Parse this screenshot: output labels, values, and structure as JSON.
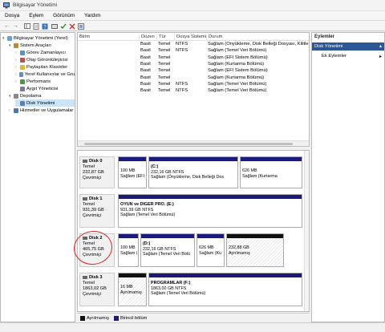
{
  "window": {
    "title": "Bilgisayar Yönetimi"
  },
  "menu": [
    "Dosya",
    "Eylem",
    "Görünüm",
    "Yardım"
  ],
  "tree": [
    {
      "label": "Bilgisayar Yönetimi (Yerel)",
      "indent": 0,
      "icon": "computer-icon"
    },
    {
      "label": "Sistem Araçları",
      "indent": 1,
      "icon": "tools-icon"
    },
    {
      "label": "Görev Zamanlayıcı",
      "indent": 2,
      "icon": "clock-icon"
    },
    {
      "label": "Olay Görüntüleyicisi",
      "indent": 2,
      "icon": "event-icon"
    },
    {
      "label": "Paylaşılan Klasörler",
      "indent": 2,
      "icon": "folder-icon"
    },
    {
      "label": "Yerel Kullanıcılar ve Gru",
      "indent": 2,
      "icon": "users-icon"
    },
    {
      "label": "Performans",
      "indent": 2,
      "icon": "performance-icon"
    },
    {
      "label": "Aygıt Yöneticisi",
      "indent": 2,
      "icon": "device-icon"
    },
    {
      "label": "Depolama",
      "indent": 1,
      "icon": "storage-icon"
    },
    {
      "label": "Disk Yönetimi",
      "indent": 2,
      "icon": "disk-icon",
      "selected": true
    },
    {
      "label": "Hizmetler ve Uygulamalar",
      "indent": 1,
      "icon": "services-icon"
    }
  ],
  "volume_columns": [
    "Birim",
    "Düzen",
    "Tür",
    "Dosya Sistemi",
    "Durum"
  ],
  "volumes": [
    {
      "name": "(C:)",
      "layout": "Basit",
      "type": "Temel",
      "fs": "NTFS",
      "status": "Sağlam (Önyükleme, Disk Belleği Dosyası, Kilitlen"
    },
    {
      "name": "(D:)",
      "layout": "Basit",
      "type": "Temel",
      "fs": "NTFS",
      "status": "Sağlam (Temel Veri Bölümü)"
    },
    {
      "name": "(Disk 0 Bölüm 1)",
      "layout": "Basit",
      "type": "Temel",
      "fs": "",
      "status": "Sağlam (EFI Sistem Bölümü)"
    },
    {
      "name": "(Disk 0 Bölüm 4)",
      "layout": "Basit",
      "type": "Temel",
      "fs": "",
      "status": "Sağlam (Kurtarma Bölümü)"
    },
    {
      "name": "(Disk 2 Bölüm 1)",
      "layout": "Basit",
      "type": "Temel",
      "fs": "",
      "status": "Sağlam (EFI Sistem Bölümü)"
    },
    {
      "name": "(Disk 2 Bölüm 4)",
      "layout": "Basit",
      "type": "Temel",
      "fs": "",
      "status": "Sağlam (Kurtarma Bölümü)"
    },
    {
      "name": "OYUN ve DİĞER PRO. (E:)",
      "layout": "Basit",
      "type": "Temel",
      "fs": "NTFS",
      "status": "Sağlam (Temel Veri Bölümü)"
    },
    {
      "name": "PROGRAMLAR (F:)",
      "layout": "Basit",
      "type": "Temel",
      "fs": "NTFS",
      "status": "Sağlam (Temel Veri Bölümü)"
    }
  ],
  "disks": [
    {
      "name": "Disk 0",
      "kind": "Temel",
      "size": "232,87 GB",
      "state": "Çevrimiçi",
      "partitions": [
        {
          "title": "",
          "line1": "100 MB",
          "line2": "Sağlam (EFI",
          "bar": "primary"
        },
        {
          "title": "(C:)",
          "line1": "232,16 GB NTFS",
          "line2": "Sağlam (Önyükleme, Disk Belleği Dos",
          "bar": "primary"
        },
        {
          "title": "",
          "line1": "626 MB",
          "line2": "Sağlam (Kurtarma",
          "bar": "primary"
        }
      ]
    },
    {
      "name": "Disk 1",
      "kind": "Temel",
      "size": "931,39 GB",
      "state": "Çevrimiçi",
      "partitions": [
        {
          "title": "OYUN ve DİĞER PRO. (E:)",
          "line1": "931,39 GB NTFS",
          "line2": "Sağlam (Temel Veri Bölümü)",
          "bar": "primary"
        }
      ]
    },
    {
      "name": "Disk 2",
      "kind": "Temel",
      "size": "465,75 GB",
      "state": "Çevrimiçi",
      "partitions": [
        {
          "title": "",
          "line1": "100 MB",
          "line2": "Sağlam (EFI",
          "bar": "primary"
        },
        {
          "title": "(D:)",
          "line1": "232,16 GB NTFS",
          "line2": "Sağlam (Temel Veri Bölü",
          "bar": "primary"
        },
        {
          "title": "",
          "line1": "626 MB",
          "line2": "Sağlam (Ku",
          "bar": "primary"
        },
        {
          "title": "",
          "line1": "232,88 GB",
          "line2": "Ayrılmamış",
          "bar": "unallocated"
        }
      ]
    },
    {
      "name": "Disk 3",
      "kind": "Temel",
      "size": "1863,02 GB",
      "state": "Çevrimiçi",
      "partitions": [
        {
          "title": "",
          "line1": "16 MB",
          "line2": "Ayrılmamış",
          "bar": "unallocated"
        },
        {
          "title": "PROGRAMLAR (F:)",
          "line1": "1863,00 GB NTFS",
          "line2": "Sağlam (Temel Veri Bölümü)",
          "bar": "primary"
        }
      ]
    }
  ],
  "legend": {
    "unallocated": "Ayrılmamış",
    "primary": "Birincil bölüm"
  },
  "colors": {
    "primary": "#1a1a7a",
    "unallocated": "#111111",
    "selected_action": "#2b5797",
    "annotation_ring": "#d42a2a"
  },
  "actions": {
    "header": "Eylemler",
    "selected": "Disk Yönetimi",
    "item": "Ek Eylemler"
  }
}
